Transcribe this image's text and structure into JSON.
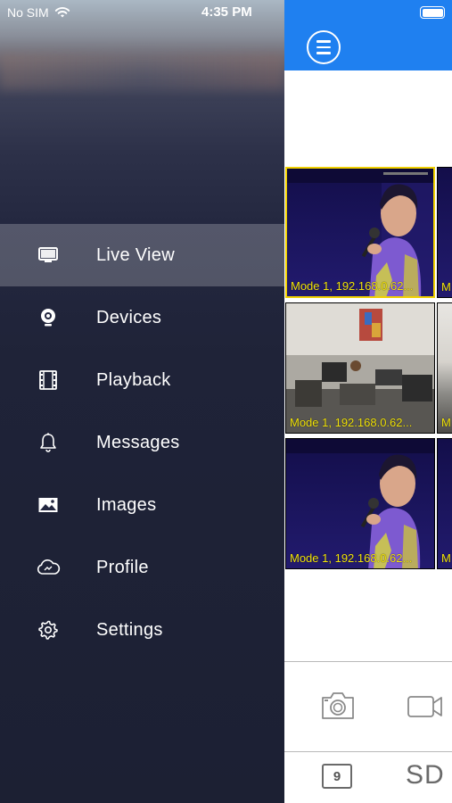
{
  "status_bar": {
    "carrier": "No SIM",
    "time": "4:35 PM"
  },
  "drawer": {
    "menu": [
      {
        "label": "Live View",
        "icon": "monitor-icon",
        "active": true
      },
      {
        "label": "Devices",
        "icon": "camera-icon",
        "active": false
      },
      {
        "label": "Playback",
        "icon": "film-icon",
        "active": false
      },
      {
        "label": "Messages",
        "icon": "bell-icon",
        "active": false
      },
      {
        "label": "Images",
        "icon": "image-icon",
        "active": false
      },
      {
        "label": "Profile",
        "icon": "cloud-icon",
        "active": false
      },
      {
        "label": "Settings",
        "icon": "gear-icon",
        "active": false
      }
    ]
  },
  "live_view": {
    "header_color": "#1f80f0",
    "tiles": [
      {
        "overlay": "Mode 1, 192.168.0.62...",
        "scene": "singer",
        "selected": true
      },
      {
        "overlay": "Mode 1, 192.168.0.62...",
        "scene": "office",
        "selected": false
      },
      {
        "overlay": "Mode 1, 192.168.0.62...",
        "scene": "singer",
        "selected": false
      }
    ],
    "partial_tile_overlay": "M",
    "bottom": {
      "grid_count_label": "9",
      "stream_label": "SD"
    }
  }
}
